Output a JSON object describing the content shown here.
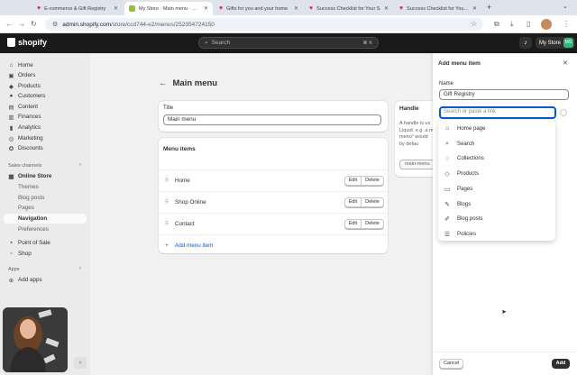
{
  "browser": {
    "tabs": [
      {
        "title": "E-commerce & Gift Registry",
        "icon": "heart-icon",
        "active": false
      },
      {
        "title": "My Store · Main menu · Shopify",
        "icon": "shopify-icon",
        "active": true
      },
      {
        "title": "Gifts for you and your home",
        "icon": "heart-icon",
        "active": false
      },
      {
        "title": "Success Checklist for Your S",
        "icon": "heart-icon",
        "active": false
      },
      {
        "title": "Success Checklist for Your S",
        "icon": "heart-icon",
        "active": false
      }
    ],
    "url_host": "admin.shopify.com",
    "url_path": "/store/ccd744-e2/menus/252354724150"
  },
  "topbar": {
    "logo_text": "shopify",
    "search_placeholder": "Search",
    "search_shortcut": "⌘ K",
    "store_label": "My Store",
    "avatar_initials": "MS"
  },
  "sidebar": {
    "items": [
      {
        "label": "Home",
        "icon": "home-icon"
      },
      {
        "label": "Orders",
        "icon": "orders-icon"
      },
      {
        "label": "Products",
        "icon": "tag-icon"
      },
      {
        "label": "Customers",
        "icon": "person-icon"
      },
      {
        "label": "Content",
        "icon": "content-icon"
      },
      {
        "label": "Finances",
        "icon": "bank-icon"
      },
      {
        "label": "Analytics",
        "icon": "chart-icon"
      },
      {
        "label": "Marketing",
        "icon": "target-icon"
      },
      {
        "label": "Discounts",
        "icon": "discount-icon"
      }
    ],
    "sales_channels_heading": "Sales channels",
    "online_store": "Online Store",
    "online_store_sub": [
      "Themes",
      "Blog posts",
      "Pages",
      "Navigation",
      "Preferences"
    ],
    "pos": "Point of Sale",
    "shop": "Shop",
    "apps_heading": "Apps",
    "add_apps": "Add apps"
  },
  "main": {
    "page_title": "Main menu",
    "title_label": "Title",
    "title_value": "Main menu",
    "menu_items_heading": "Menu items",
    "menu_items": [
      "Home",
      "Shop Online",
      "Contact"
    ],
    "edit_label": "Edit",
    "delete_label": "Delete",
    "add_menu_item": "Add menu item",
    "handle_heading": "Handle",
    "handle_text_1": "A handle is us",
    "handle_text_2": "Liquid. e.g. a m",
    "handle_text_3": "menu\" would",
    "handle_text_4": "by defau",
    "handle_value": "main-menu"
  },
  "drawer": {
    "title": "Add menu item",
    "name_label": "Name",
    "name_value": "Gift Registry",
    "link_placeholder": "Search or paste a link",
    "options": [
      {
        "label": "Home page",
        "icon": "home-icon"
      },
      {
        "label": "Search",
        "icon": "search-icon"
      },
      {
        "label": "Collections",
        "icon": "collection-icon"
      },
      {
        "label": "Products",
        "icon": "tag-icon"
      },
      {
        "label": "Pages",
        "icon": "page-icon"
      },
      {
        "label": "Blogs",
        "icon": "blog-icon"
      },
      {
        "label": "Blog posts",
        "icon": "blog-post-icon"
      },
      {
        "label": "Policies",
        "icon": "policy-icon"
      }
    ],
    "cancel_label": "Cancel",
    "add_label": "Add"
  }
}
